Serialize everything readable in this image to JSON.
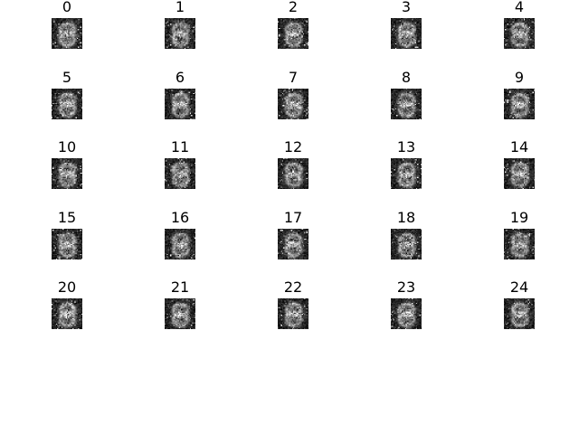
{
  "figure": {
    "panels": [
      {
        "label": "0"
      },
      {
        "label": "1"
      },
      {
        "label": "2"
      },
      {
        "label": "3"
      },
      {
        "label": "4"
      },
      {
        "label": "5"
      },
      {
        "label": "6"
      },
      {
        "label": "7"
      },
      {
        "label": "8"
      },
      {
        "label": "9"
      },
      {
        "label": "10"
      },
      {
        "label": "11"
      },
      {
        "label": "12"
      },
      {
        "label": "13"
      },
      {
        "label": "14"
      },
      {
        "label": "15"
      },
      {
        "label": "16"
      },
      {
        "label": "17"
      },
      {
        "label": "18"
      },
      {
        "label": "19"
      },
      {
        "label": "20"
      },
      {
        "label": "21"
      },
      {
        "label": "22"
      },
      {
        "label": "23"
      },
      {
        "label": "24"
      }
    ],
    "grid": {
      "rows": 5,
      "cols": 5
    },
    "colormap": "gray",
    "background_color": "#ffffff"
  }
}
